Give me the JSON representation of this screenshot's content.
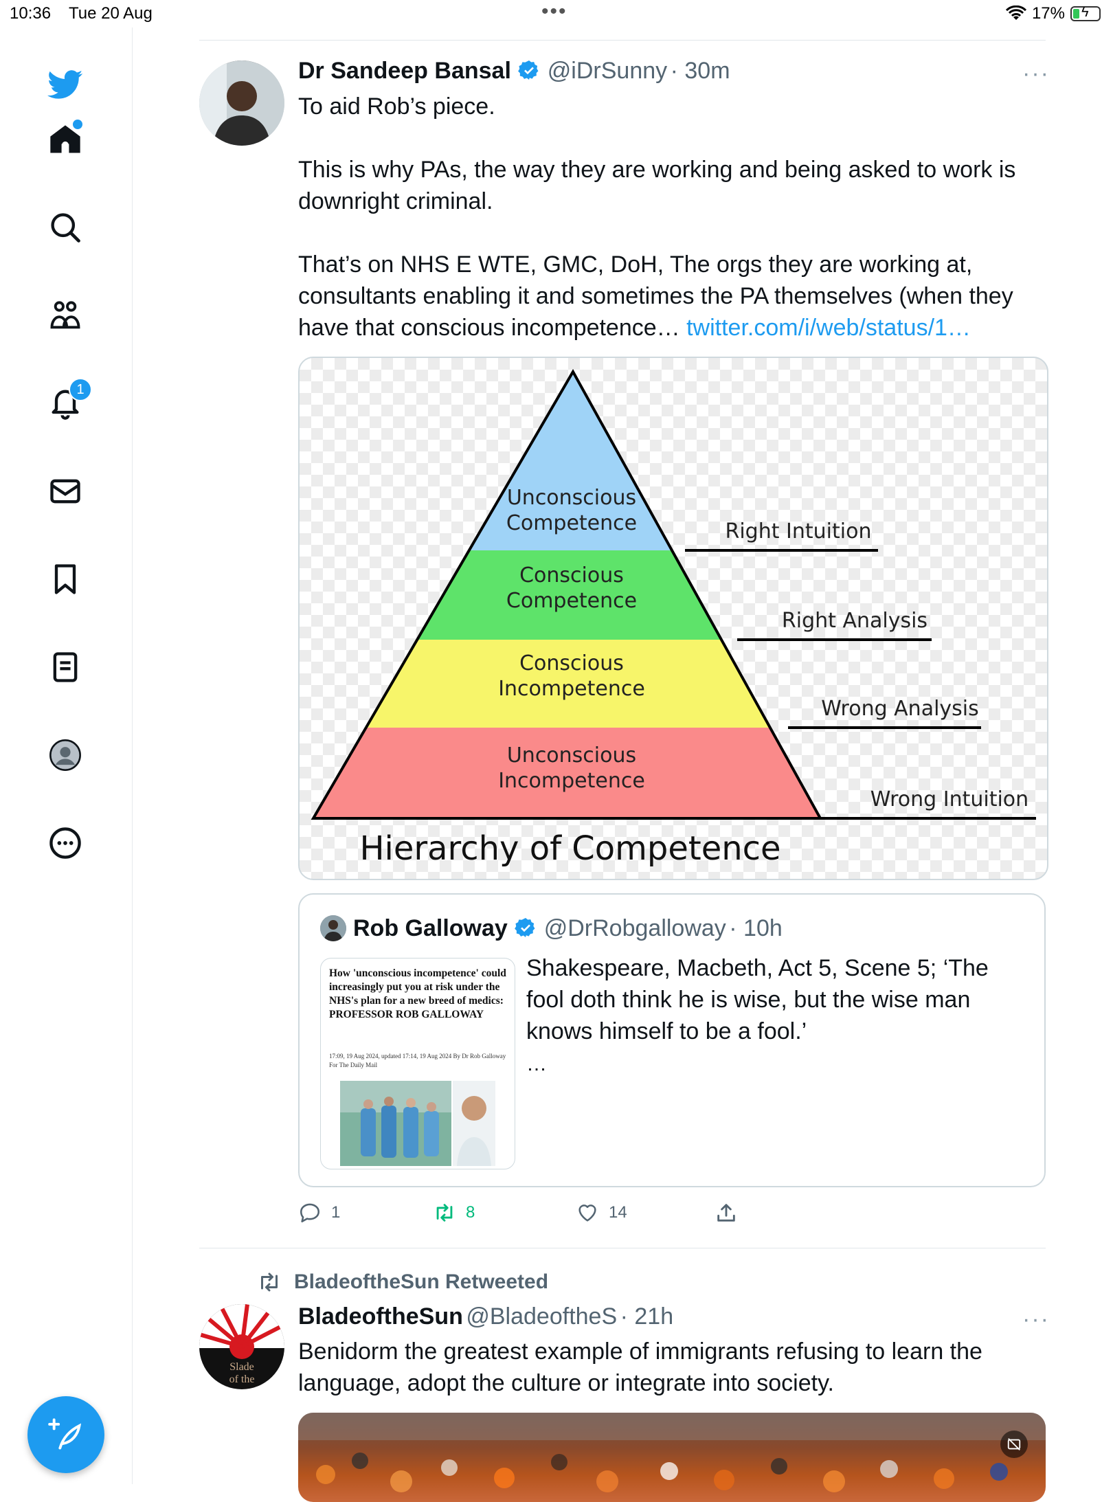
{
  "status_bar": {
    "time": "10:36",
    "date": "Tue 20 Aug",
    "battery": "17%",
    "icons": [
      "wifi-icon",
      "battery-charging-icon"
    ]
  },
  "sidebar": {
    "items": [
      {
        "name": "twitter-logo",
        "icon": "bird-icon"
      },
      {
        "name": "home",
        "icon": "home-icon"
      },
      {
        "name": "explore",
        "icon": "search-icon"
      },
      {
        "name": "communities",
        "icon": "people-icon"
      },
      {
        "name": "notifications",
        "icon": "bell-icon",
        "badge": "1"
      },
      {
        "name": "messages",
        "icon": "envelope-icon"
      },
      {
        "name": "bookmarks",
        "icon": "bookmark-icon"
      },
      {
        "name": "lists",
        "icon": "list-icon"
      },
      {
        "name": "profile",
        "icon": "profile-icon"
      },
      {
        "name": "more",
        "icon": "more-circle-icon"
      }
    ],
    "compose_icon": "feather-plus-icon",
    "accent": "#1d9bf0"
  },
  "tweet1": {
    "name": "Dr Sandeep Bansal",
    "handle": "@iDrSunny",
    "time": "30m",
    "more": "···",
    "line1": "To aid Rob’s piece.",
    "para2": "This is why PAs, the way they are working and being asked to work is downright criminal.",
    "para3": "That’s on NHS E WTE, GMC, DoH, The orgs they are working at, consultants enabling it and sometimes the PA themselves (when they have that conscious incompetence…",
    "link": "twitter.com/i/web/status/1…",
    "image": {
      "levels": [
        {
          "label_line1": "Unconscious",
          "label_line2": "Competence",
          "color": "#9fd3f7",
          "side": "Right Intuition"
        },
        {
          "label_line1": "Conscious",
          "label_line2": "Competence",
          "color": "#5ee36a",
          "side": "Right Analysis"
        },
        {
          "label_line1": "Conscious",
          "label_line2": "Incompetence",
          "color": "#f7f56a",
          "side": "Wrong Analysis"
        },
        {
          "label_line1": "Unconscious",
          "label_line2": "Incompetence",
          "color": "#fa8a8a",
          "side": "Wrong Intuition"
        }
      ],
      "caption": "Hierarchy of Competence"
    },
    "quote": {
      "name": "Rob Galloway",
      "handle": "@DrRobgalloway",
      "time": "10h",
      "text": "Shakespeare, Macbeth, Act 5, Scene 5; ‘The fool doth think he is wise, but the wise man knows himself to be a fool.’",
      "ellipsis": "…",
      "article_title": "How 'unconscious incompetence' could increasingly put you at risk under the NHS's plan for a new breed of medics: PROFESSOR ROB GALLOWAY",
      "article_meta": "17:09, 19 Aug 2024, updated 17:14, 19 Aug 2024 By Dr Rob Galloway For The Daily Mail"
    },
    "actions": {
      "replies": "1",
      "retweets": "8",
      "likes": "14"
    }
  },
  "tweet2": {
    "retweeted_by": "BladeoftheSun Retweeted",
    "name": "BladeoftheSun",
    "handle": "@BladeoftheS",
    "time": "21h",
    "more": "···",
    "text": "Benidorm the greatest example of immigrants refusing to learn the language, adopt the culture or integrate into society.",
    "avatar_text1": "Slade",
    "avatar_text2": "of the"
  }
}
